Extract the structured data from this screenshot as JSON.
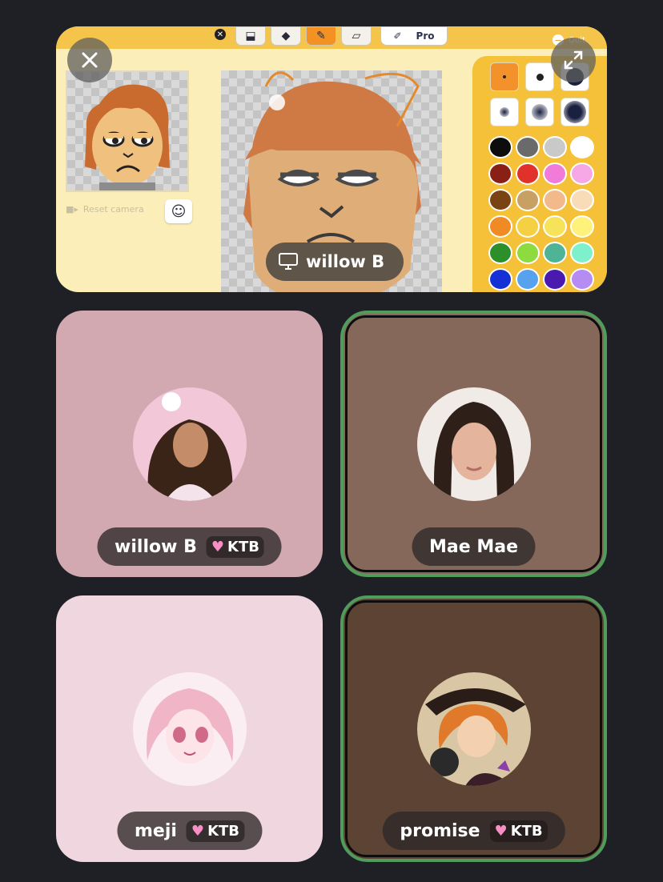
{
  "screen_share": {
    "presenter_name": "willow B",
    "reset_camera_label": "Reset camera",
    "pro_label": "Pro",
    "quit_label": "Quit",
    "palette_colors": [
      [
        "#0d0d0d",
        "#6a6a6a",
        "#c9c9c9",
        "#ffffff"
      ],
      [
        "#8a1f16",
        "#e0322b",
        "#f07bd8",
        "#f6a7e5"
      ],
      [
        "#7a4314",
        "#c8a064",
        "#f2b98a",
        "#f8dcb8"
      ],
      [
        "#f08a24",
        "#f6d043",
        "#f6e35a",
        "#fff27a"
      ],
      [
        "#2d8f2a",
        "#8ddb3e",
        "#4fb496",
        "#7ff0cc"
      ],
      [
        "#1531d6",
        "#57a2ef",
        "#4a1ab0",
        "#b58cf2"
      ]
    ]
  },
  "participants": [
    {
      "name": "willow B",
      "tag": "KTB",
      "tile_color": "#d3a9b1",
      "speaking": false
    },
    {
      "name": "Mae Mae",
      "tag": "",
      "tile_color": "#85685a",
      "speaking": true
    },
    {
      "name": "meji",
      "tag": "KTB",
      "tile_color": "#efd6df",
      "speaking": false
    },
    {
      "name": "promise",
      "tag": "KTB",
      "tile_color": "#5c4333",
      "speaking": true
    }
  ]
}
